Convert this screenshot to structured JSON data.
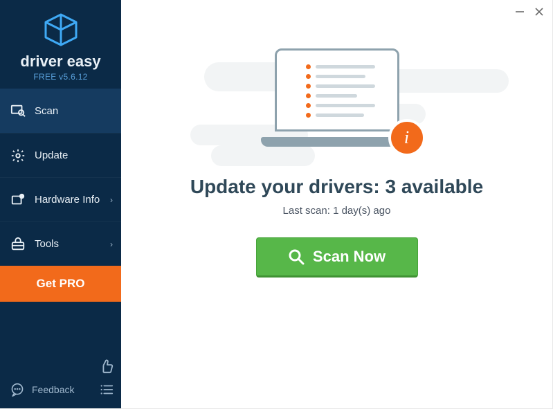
{
  "brand": {
    "name": "driver easy",
    "version_line": "FREE v5.6.12"
  },
  "nav": {
    "scan": {
      "label": "Scan"
    },
    "update": {
      "label": "Update"
    },
    "hw": {
      "label": "Hardware Info"
    },
    "tools": {
      "label": "Tools"
    }
  },
  "get_pro_label": "Get PRO",
  "feedback_label": "Feedback",
  "main": {
    "headline": "Update your drivers: 3 available",
    "subline": "Last scan: 1 day(s) ago",
    "scan_label": "Scan Now",
    "info_glyph": "i"
  }
}
